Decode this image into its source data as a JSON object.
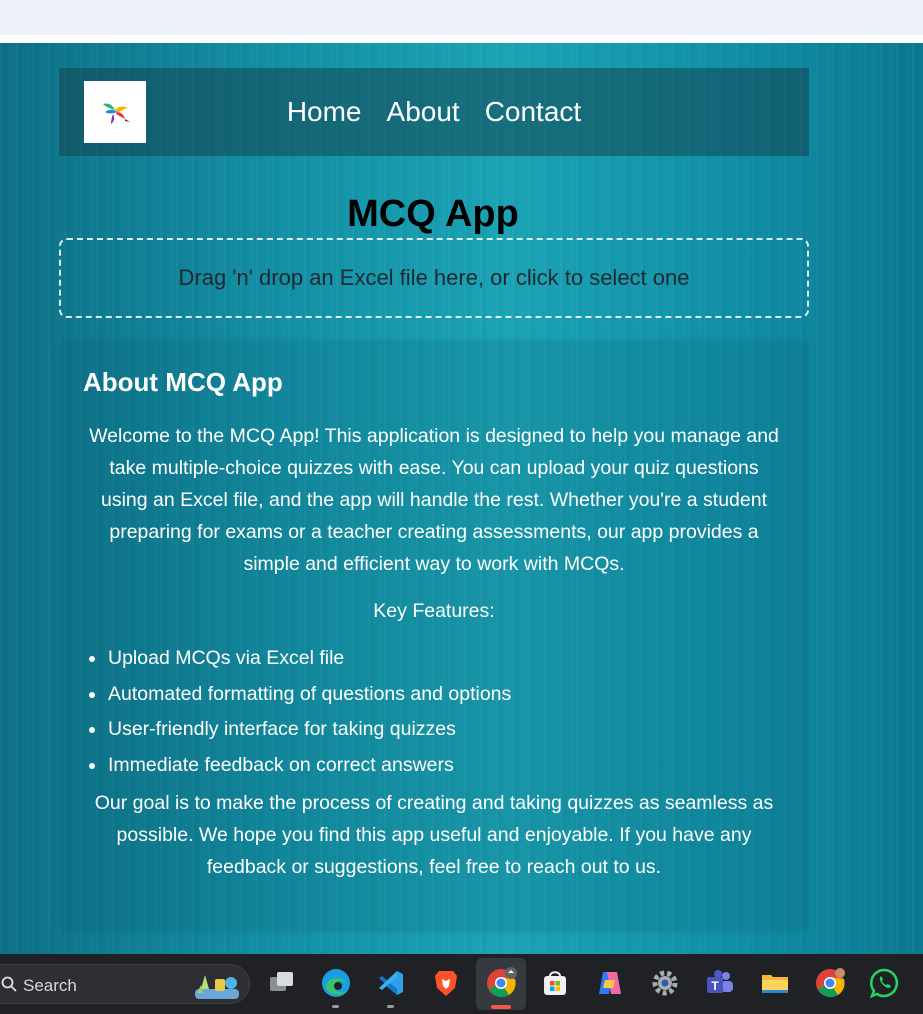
{
  "nav": {
    "links": [
      "Home",
      "About",
      "Contact"
    ]
  },
  "page": {
    "title": "MCQ App",
    "dropzone_text": "Drag 'n' drop an Excel file here, or click to select one"
  },
  "about": {
    "title": "About MCQ App",
    "intro": "Welcome to the MCQ App! This application is designed to help you manage and take multiple-choice quizzes with ease. You can upload your quiz questions using an Excel file, and the app will handle the rest. Whether you're a student preparing for exams or a teacher creating assessments, our app provides a simple and efficient way to work with MCQs.",
    "features_heading": "Key Features:",
    "features": [
      "Upload MCQs via Excel file",
      "Automated formatting of questions and options",
      "User-friendly interface for taking quizzes",
      "Immediate feedback on correct answers"
    ],
    "goal": "Our goal is to make the process of creating and taking quizzes as seamless as possible. We hope you find this app useful and enjoyable. If you have any feedback or suggestions, feel free to reach out to us."
  },
  "taskbar": {
    "search_label": "Search",
    "apps": [
      "task-view",
      "edge",
      "vscode",
      "brave",
      "chrome",
      "microsoft-store",
      "copilot",
      "settings",
      "teams",
      "file-explorer",
      "chrome-profile",
      "whatsapp"
    ]
  },
  "colors": {
    "page_background": "#128fa5",
    "navbar": "#1f5a63",
    "text": "#ffffff",
    "title": "#000000",
    "taskbar": "#1f2124"
  }
}
